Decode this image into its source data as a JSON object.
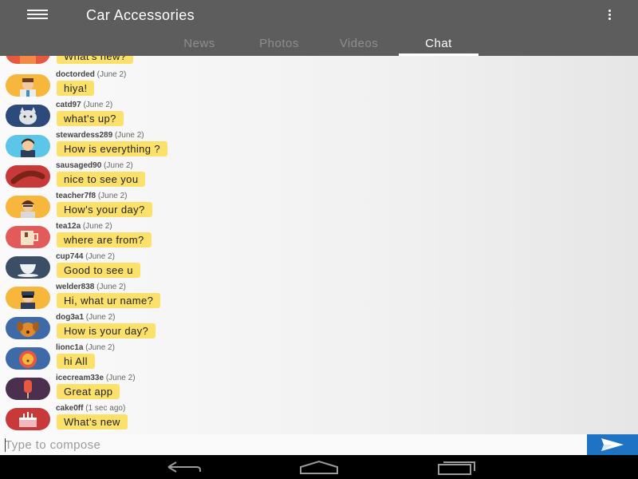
{
  "app": {
    "title": "Car Accessories",
    "menu_icon": "hamburger-menu-icon",
    "overflow_icon": "more-vert-icon"
  },
  "tabs": [
    {
      "label": "News",
      "active": false
    },
    {
      "label": "Photos",
      "active": false
    },
    {
      "label": "Videos",
      "active": false
    },
    {
      "label": "Chat",
      "active": true
    }
  ],
  "chat": {
    "partial_top_message": {
      "text": "What's new?",
      "avatar": "orange-avatar"
    },
    "messages": [
      {
        "user": "doctorded",
        "time": "(June 2)",
        "text": "hiya!",
        "avatar": "doctor-avatar"
      },
      {
        "user": "catd97",
        "time": "(June 2)",
        "text": "what's up?",
        "avatar": "cat-avatar"
      },
      {
        "user": "stewardess289",
        "time": "(June 2)",
        "text": "How is everything ?",
        "avatar": "stewardess-avatar"
      },
      {
        "user": "sausaged90",
        "time": "(June 2)",
        "text": "nice to see you",
        "avatar": "sausage-avatar"
      },
      {
        "user": "teacher7f8",
        "time": "(June 2)",
        "text": "How's your day?",
        "avatar": "teacher-avatar"
      },
      {
        "user": "tea12a",
        "time": "(June 2)",
        "text": "where are from?",
        "avatar": "tea-avatar"
      },
      {
        "user": "cup744",
        "time": "(June 2)",
        "text": "Good to see u",
        "avatar": "cup-avatar"
      },
      {
        "user": "welder838",
        "time": "(June 2)",
        "text": "Hi, what ur name?",
        "avatar": "welder-avatar"
      },
      {
        "user": "dog3a1",
        "time": "(June 2)",
        "text": "How is your day?",
        "avatar": "dog-avatar"
      },
      {
        "user": "lionc1a",
        "time": "(June 2)",
        "text": "hi All",
        "avatar": "lion-avatar"
      },
      {
        "user": "icecream33e",
        "time": "(June 2)",
        "text": "Great app",
        "avatar": "icecream-avatar"
      },
      {
        "user": "cake0ff",
        "time": "(1 sec ago)",
        "text": "What's new",
        "avatar": "cake-avatar"
      }
    ]
  },
  "compose": {
    "placeholder": "Type to compose",
    "value": "",
    "send_icon": "send-icon"
  },
  "navbar": {
    "back_icon": "back-icon",
    "home_icon": "home-icon",
    "recents_icon": "recents-icon"
  }
}
